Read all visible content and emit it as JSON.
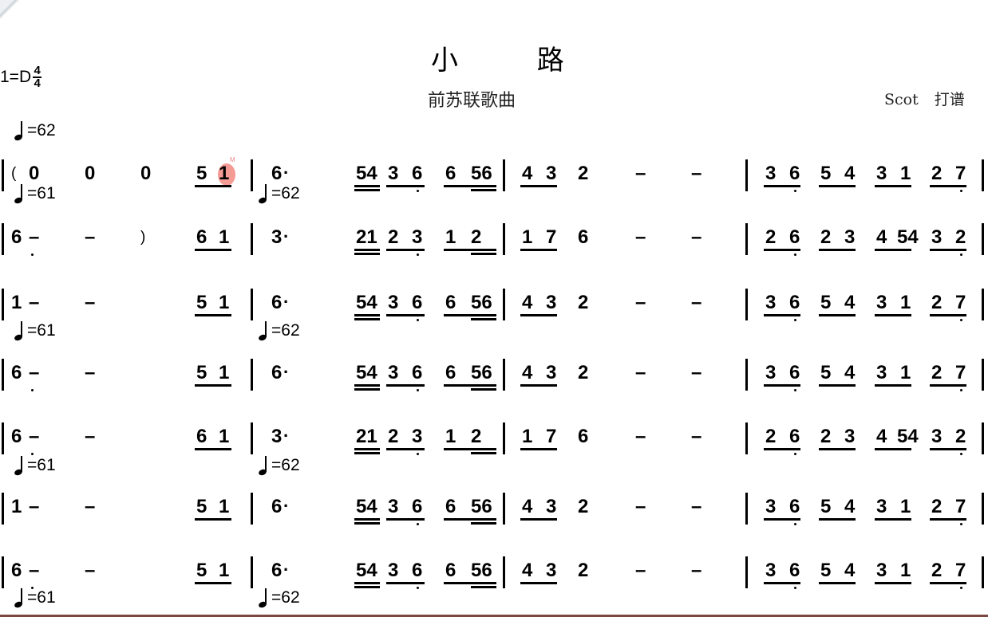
{
  "title": "小 路",
  "subtitle": "前苏联歌曲",
  "credit": {
    "author": "Scot",
    "role": "打谱"
  },
  "key": {
    "label": "1=D",
    "time_top": "4",
    "time_bottom": "4"
  },
  "tempo_marks": [
    "=62",
    "=61",
    "=62",
    "=61",
    "=62",
    "=61",
    "=62",
    "=61",
    "=62"
  ],
  "cursor_note": {
    "value": "1",
    "marker": "M"
  },
  "rows": [
    {
      "m1": [
        "(",
        "0",
        "0",
        "0",
        "5",
        "1"
      ],
      "m2": [
        "6",
        "54",
        "3",
        "6",
        "6",
        "56"
      ],
      "m3": [
        "4",
        "3",
        "2",
        "–",
        "–"
      ],
      "m4": [
        "3",
        "6",
        "5",
        "4",
        "3",
        "1",
        "2",
        "7"
      ]
    },
    {
      "m1": [
        "6",
        "–",
        "–",
        ")",
        "6",
        "1"
      ],
      "m2": [
        "3",
        "21",
        "2",
        "3",
        "1",
        "2"
      ],
      "m3": [
        "1",
        "7",
        "6",
        "–",
        "–"
      ],
      "m4": [
        "2",
        "6",
        "2",
        "3",
        "4",
        "54",
        "3",
        "2"
      ]
    },
    {
      "m1": [
        "1",
        "–",
        "–",
        "",
        "5",
        "1"
      ],
      "m2": [
        "6",
        "54",
        "3",
        "6",
        "6",
        "56"
      ],
      "m3": [
        "4",
        "3",
        "2",
        "–",
        "–"
      ],
      "m4": [
        "3",
        "6",
        "5",
        "4",
        "3",
        "1",
        "2",
        "7"
      ]
    },
    {
      "m1": [
        "6",
        "–",
        "–",
        "",
        "5",
        "1"
      ],
      "m2": [
        "6",
        "54",
        "3",
        "6",
        "6",
        "56"
      ],
      "m3": [
        "4",
        "3",
        "2",
        "–",
        "–"
      ],
      "m4": [
        "3",
        "6",
        "5",
        "4",
        "3",
        "1",
        "2",
        "7"
      ]
    },
    {
      "m1": [
        "6",
        "–",
        "–",
        "",
        "6",
        "1"
      ],
      "m2": [
        "3",
        "21",
        "2",
        "3",
        "1",
        "2"
      ],
      "m3": [
        "1",
        "7",
        "6",
        "–",
        "–"
      ],
      "m4": [
        "2",
        "6",
        "2",
        "3",
        "4",
        "54",
        "3",
        "2"
      ]
    },
    {
      "m1": [
        "1",
        "–",
        "–",
        "",
        "5",
        "1"
      ],
      "m2": [
        "6",
        "54",
        "3",
        "6",
        "6",
        "56"
      ],
      "m3": [
        "4",
        "3",
        "2",
        "–",
        "–"
      ],
      "m4": [
        "3",
        "6",
        "5",
        "4",
        "3",
        "1",
        "2",
        "7"
      ]
    },
    {
      "m1": [
        "6",
        "–",
        "–",
        "",
        "5",
        "1"
      ],
      "m2": [
        "6",
        "54",
        "3",
        "6",
        "6",
        "56"
      ],
      "m3": [
        "4",
        "3",
        "2",
        "–",
        "–"
      ],
      "m4": [
        "3",
        "6",
        "5",
        "4",
        "3",
        "1",
        "2",
        "7"
      ]
    }
  ]
}
